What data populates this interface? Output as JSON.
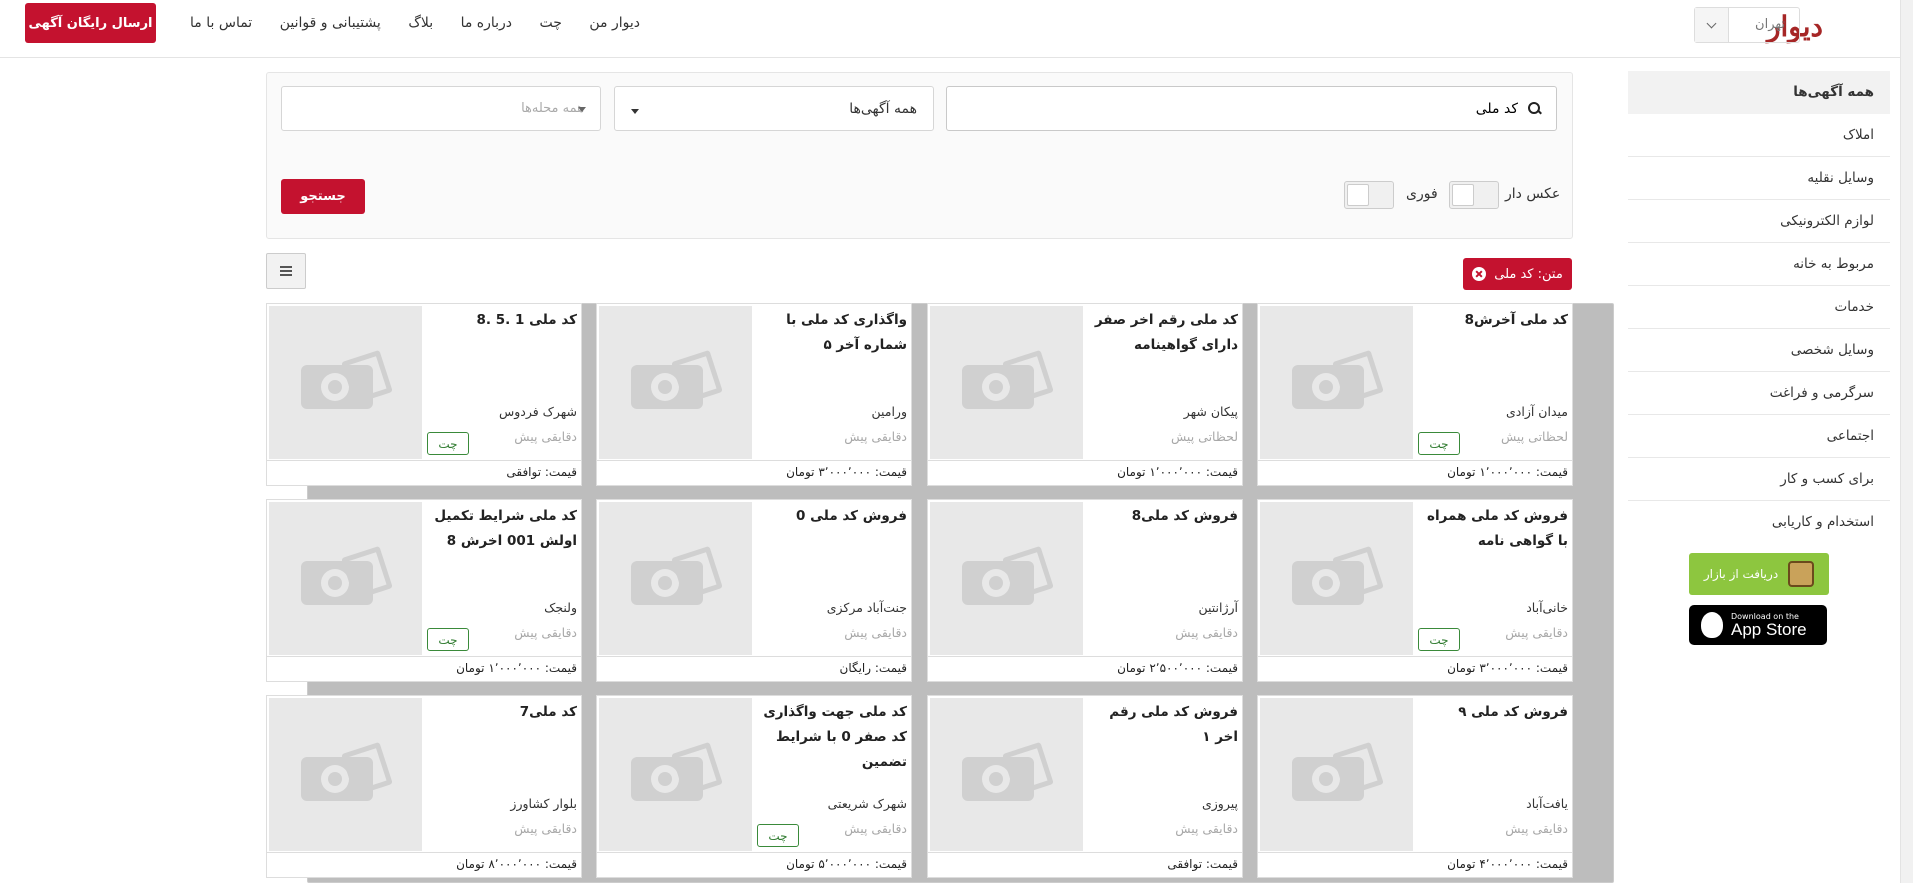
{
  "header": {
    "logo": "دیوار",
    "city": "تهران",
    "nav": [
      "دیوار من",
      "چت",
      "درباره ما",
      "بلاگ",
      "پشتیبانی و قوانین",
      "تماس با ما"
    ],
    "post_button": "ارسال رایگان آگهی"
  },
  "sidebar": {
    "categories": [
      "همه آگهی‌ها",
      "املاک",
      "وسایل نقلیه",
      "لوازم الکترونیکی",
      "مربوط به خانه",
      "خدمات",
      "وسایل شخصی",
      "سرگرمی و فراغت",
      "اجتماعی",
      "برای کسب و کار",
      "استخدام و کاریابی"
    ],
    "bazaar_label": "دریافت از بازار",
    "appstore_small": "Download on the",
    "appstore_big": "App Store"
  },
  "search": {
    "query": "کد ملی",
    "category_select": "همه آگهی‌ها",
    "neighborhood_placeholder": "همه محله‌ها",
    "toggle_photo": "عکس دار",
    "toggle_urgent": "فوری",
    "submit": "جستجو"
  },
  "filter_chip": "متن: کد ملی",
  "cards": [
    {
      "title": "کد ملی آخرش8",
      "location": "میدان آزادی",
      "time": "لحظاتی پیش",
      "price": "قیمت: ۱٬۰۰۰٬۰۰۰ تومان",
      "chat": true
    },
    {
      "title": "کد ملی رقم اخر صفر دارای گواهینامه",
      "location": "پیکان شهر",
      "time": "لحظاتی پیش",
      "price": "قیمت: ۱٬۰۰۰٬۰۰۰ تومان",
      "chat": false
    },
    {
      "title": "واگذاری کد ملی با شماره آخر ۵",
      "location": "ورامین",
      "time": "دقایقی پیش",
      "price": "قیمت: ۳٬۰۰۰٬۰۰۰ تومان",
      "chat": false
    },
    {
      "title": "کد ملی 1 .5 .8",
      "location": "شهرک فردوس",
      "time": "دقایقی پیش",
      "price": "قیمت: توافقی",
      "chat": true
    },
    {
      "title": "فروش کد ملی همراه با گواهی نامه",
      "location": "خانی‌آباد",
      "time": "دقایقی پیش",
      "price": "قیمت: ۳٬۰۰۰٬۰۰۰ تومان",
      "chat": true
    },
    {
      "title": "فروش کد ملی8",
      "location": "آرژانتین",
      "time": "دقایقی پیش",
      "price": "قیمت: ۲٬۵۰۰٬۰۰۰ تومان",
      "chat": false
    },
    {
      "title": "فروش کد ملی 0",
      "location": "جنت‌آباد مرکزی",
      "time": "دقایقی پیش",
      "price": "قیمت: رایگان",
      "chat": false
    },
    {
      "title": "کد ملی شرایط تکمیل اولش 001 اخرش 8",
      "location": "ولنجک",
      "time": "دقایقی پیش",
      "price": "قیمت: ۱٬۰۰۰٬۰۰۰ تومان",
      "chat": true
    },
    {
      "title": "فروش کد ملی ۹",
      "location": "یافت‌آباد",
      "time": "دقایقی پیش",
      "price": "قیمت: ۴٬۰۰۰٬۰۰۰ تومان",
      "chat": false
    },
    {
      "title": "فروش کد ملی رقم اخر ۱",
      "location": "پیروزی",
      "time": "دقایقی پیش",
      "price": "قیمت: توافقی",
      "chat": false
    },
    {
      "title": "کد ملی جهت واگذاری کد صفر 0 با شرایط تضمین",
      "location": "شهرک شریعتی",
      "time": "دقایقی پیش",
      "price": "قیمت: ۵٬۰۰۰٬۰۰۰ تومان",
      "chat": true
    },
    {
      "title": "کد ملی7",
      "location": "بلوار کشاورز",
      "time": "دقایقی پیش",
      "price": "قیمت: ۸٬۰۰۰٬۰۰۰ تومان",
      "chat": false
    }
  ],
  "chat_label": "چت",
  "colors": {
    "brand": "#c4122f",
    "chat_green": "#2d7a2d",
    "bazaar_green": "#8dc63f"
  }
}
